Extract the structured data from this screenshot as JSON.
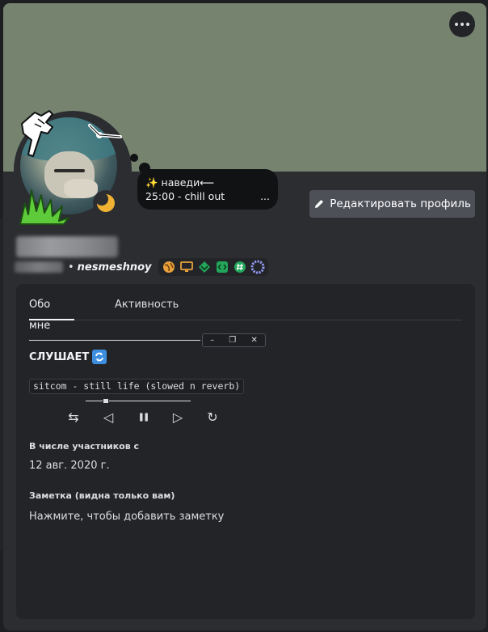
{
  "header": {
    "more_icon": "ellipsis-icon",
    "banner_color": "#75836f"
  },
  "avatar": {
    "decoration_icons": [
      "pointing-hand-icon",
      "clock-hands-icon",
      "grass-icon"
    ],
    "status": "idle",
    "status_icon": "crescent-moon-icon",
    "status_color": "#f0b232"
  },
  "custom_status": {
    "line1": "✨ наведи⟵",
    "line2": "25:00 - chill out",
    "more": "..."
  },
  "edit_profile": {
    "icon": "pencil-icon",
    "label": "Редактировать профиль"
  },
  "user": {
    "handle": "nesmeshnoy",
    "separator": "•",
    "badges": [
      "globe-icon",
      "monitor-icon",
      "gem-icon",
      "code-icon",
      "hashtag-icon",
      "gear-ring-icon"
    ]
  },
  "tabs": [
    {
      "label": "Обо мне",
      "active": true
    },
    {
      "label": "Активность",
      "active": false
    }
  ],
  "about": {
    "window_controls": [
      "–",
      "❐",
      "✕"
    ],
    "listening_label": "СЛУШАЕТ",
    "listening_icon": "repeat-icon",
    "track": "sitcom - still life (slowed n reverb)",
    "progress": 0.19,
    "controls": {
      "shuffle": "⇆",
      "prev": "◁",
      "pause": "❚❚",
      "next": "▷",
      "repeat": "↻"
    }
  },
  "member_since": {
    "title": "В числе участников с",
    "value": "12 авг. 2020 г."
  },
  "note": {
    "title": "Заметка (видна только вам)",
    "placeholder": "Нажмите, чтобы добавить заметку"
  }
}
